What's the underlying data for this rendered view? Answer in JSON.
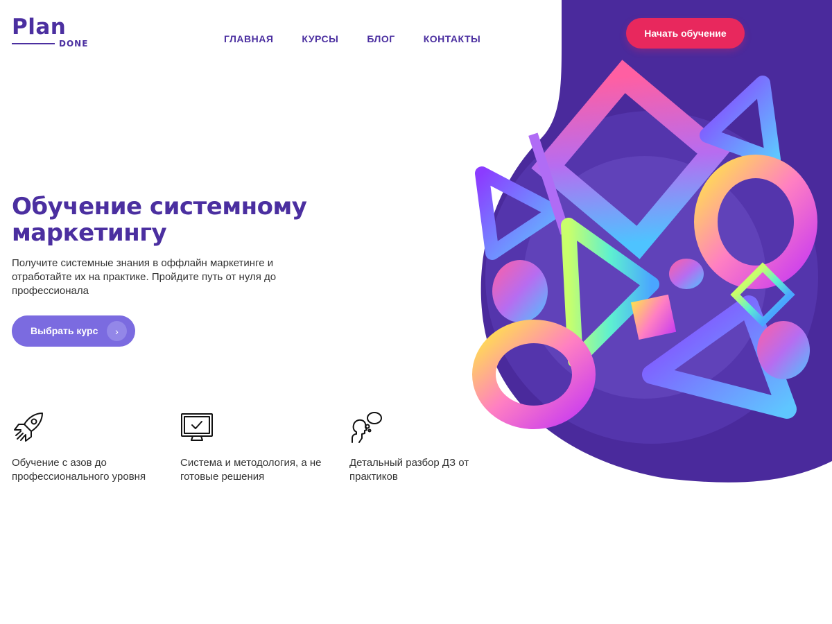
{
  "logo": {
    "main": "Plan",
    "sub": "DONE"
  },
  "nav": {
    "items": [
      {
        "label": "ГЛАВНАЯ"
      },
      {
        "label": "КУРСЫ"
      },
      {
        "label": "БЛОГ"
      },
      {
        "label": "КОНТАКТЫ"
      }
    ]
  },
  "header": {
    "cta_label": "Начать обучение"
  },
  "hero": {
    "title": "Обучение системному маркетингу",
    "description": "Получите системные знания в оффлайн маркетинге и отработайте их на практике. Пройдите путь от нуля до профессионала",
    "button_label": "Выбрать курс",
    "button_arrow": "›"
  },
  "features": [
    {
      "icon": "rocket-icon",
      "text": "Обучение с азов до профессионального уровня"
    },
    {
      "icon": "monitor-check-icon",
      "text": "Система и методология, а не готовые решения"
    },
    {
      "icon": "person-thought-icon",
      "text": "Детальный разбор ДЗ от практиков"
    }
  ],
  "colors": {
    "brand_purple": "#4b2fa0",
    "accent_red": "#e8285d",
    "button_violet": "#7b6be0",
    "blob_purple": "#4a2a9c"
  }
}
